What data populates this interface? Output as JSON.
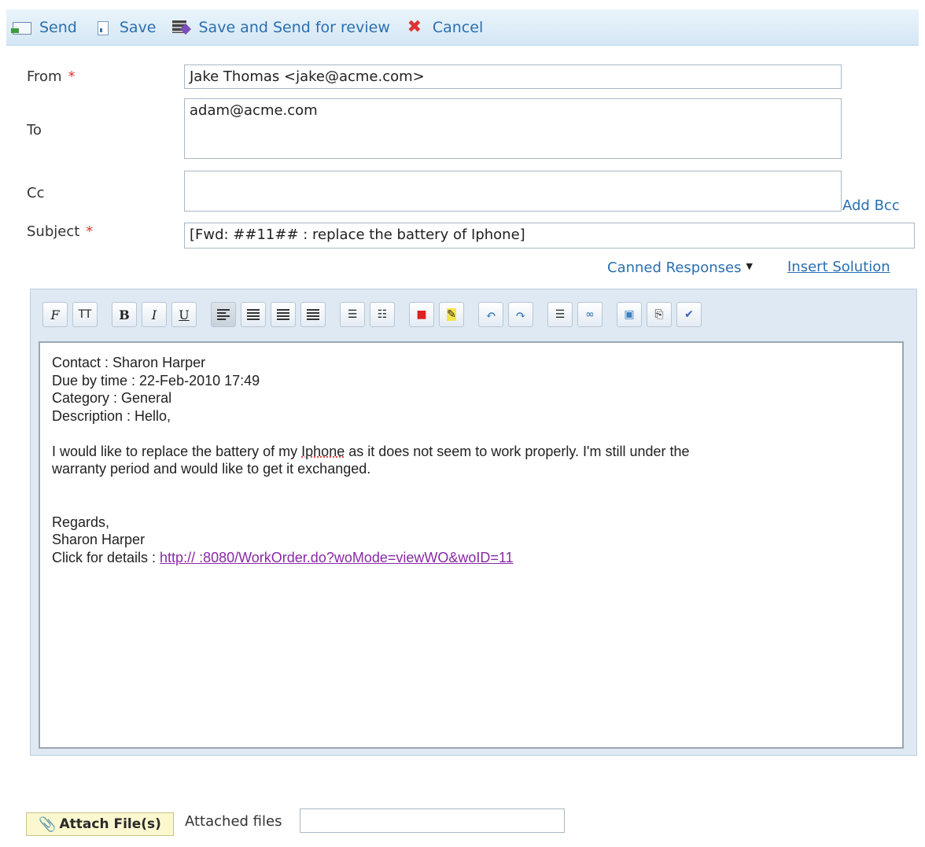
{
  "toolbar": {
    "send": "Send",
    "save": "Save",
    "save_review": "Save and Send for review",
    "cancel": "Cancel",
    "cancel_glyph": "✖"
  },
  "form": {
    "from_label": "From",
    "from_value": "Jake Thomas <jake@acme.com>",
    "to_label": "To",
    "to_value": "adam@acme.com",
    "cc_label": "Cc",
    "cc_value": "",
    "add_bcc": "Add Bcc",
    "subject_label": "Subject",
    "subject_value": "[Fwd: ##11## : replace the battery of Iphone]",
    "required_mark": "*"
  },
  "links": {
    "canned": "Canned Responses",
    "insert_solution": "Insert Solution"
  },
  "editor_toolbar": {
    "font": "F",
    "font_size": "TT",
    "bold": "B",
    "italic": "I",
    "underline": "U"
  },
  "body": {
    "line1": "Contact : Sharon Harper",
    "line2": "Due by time : 22-Feb-2010 17:49",
    "line3": "Category : General",
    "line4": "Description : Hello,",
    "para_a": "I would like to replace the battery of my ",
    "para_b": "Iphone",
    "para_c": " as it does not seem to work properly. I'm still under the",
    "para2": "warranty period and would like to get it exchanged.",
    "regards": "Regards,",
    "sig": "Sharon Harper",
    "click_label": "Click for details : ",
    "link": "http://            :8080/WorkOrder.do?woMode=viewWO&woID=11"
  },
  "attach": {
    "button": "Attach File(s)",
    "label": "Attached files"
  },
  "colors": {
    "link_blue": "#2a6fb0",
    "required_red": "#e03030",
    "url_purple": "#8a2aa6"
  }
}
